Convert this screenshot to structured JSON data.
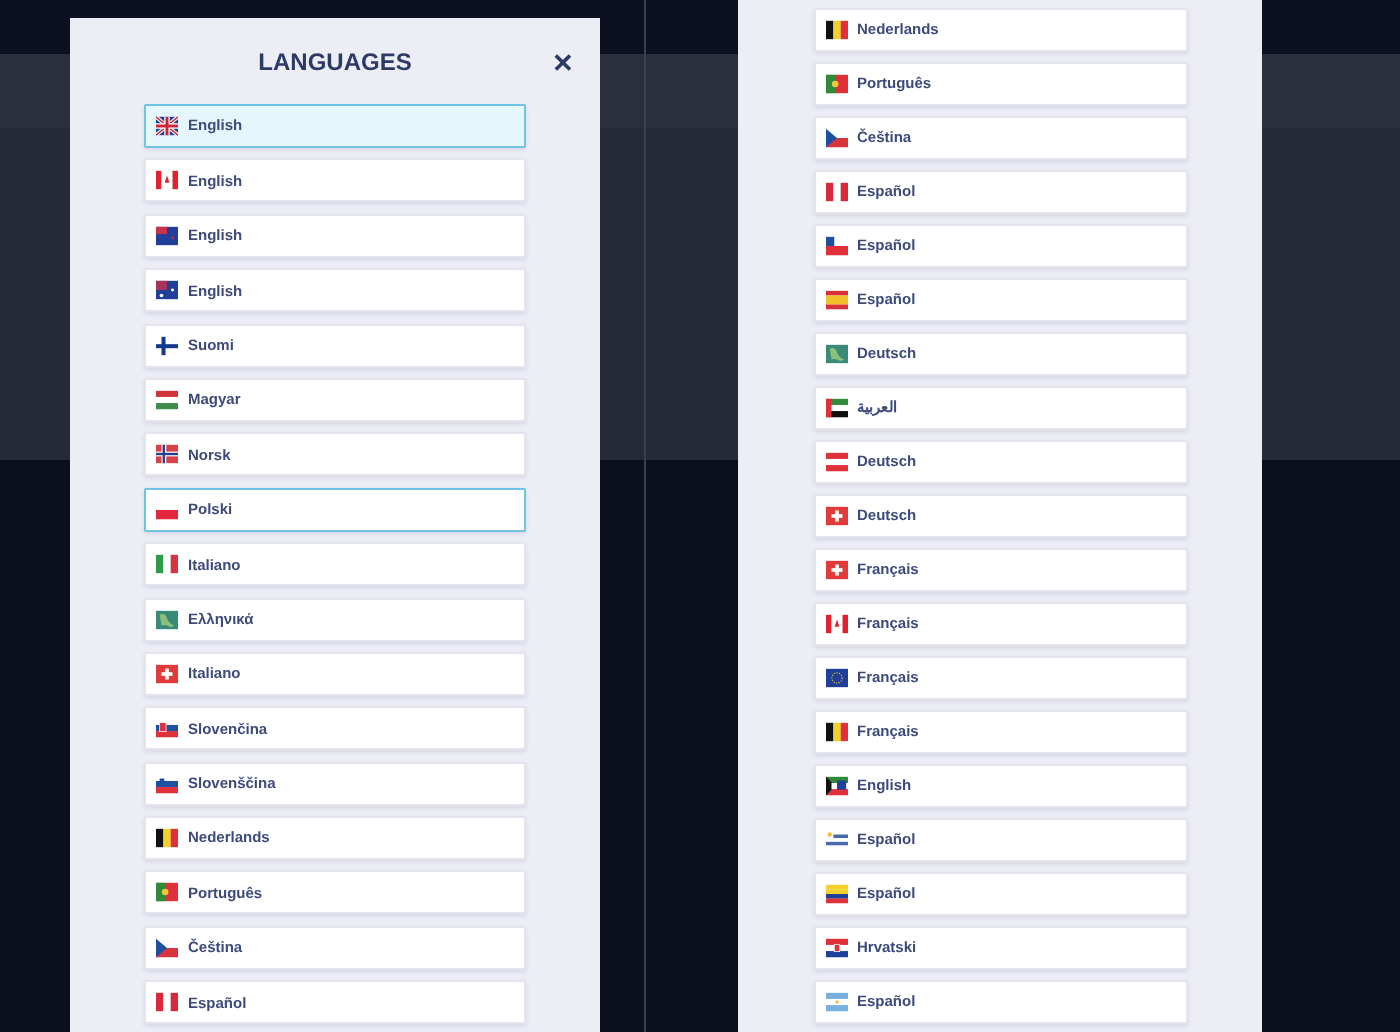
{
  "left_panel": {
    "dialog": {
      "title": "LANGUAGES",
      "close": "✕",
      "languages": [
        {
          "label": "English",
          "kind": "gb",
          "selected": true,
          "focused": false
        },
        {
          "label": "English",
          "kind": "ca",
          "selected": false,
          "focused": false
        },
        {
          "label": "English",
          "kind": "nz",
          "selected": false,
          "focused": false
        },
        {
          "label": "English",
          "kind": "au",
          "selected": false,
          "focused": false
        },
        {
          "label": "Suomi",
          "kind": "fi",
          "selected": false,
          "focused": false
        },
        {
          "label": "Magyar",
          "kind": "hu",
          "selected": false,
          "focused": false
        },
        {
          "label": "Norsk",
          "kind": "no",
          "selected": false,
          "focused": false
        },
        {
          "label": "Polski",
          "kind": "pl",
          "selected": false,
          "focused": true
        },
        {
          "label": "Italiano",
          "kind": "it",
          "selected": false,
          "focused": false
        },
        {
          "label": "Ελληνικά",
          "kind": "globe",
          "selected": false,
          "focused": false
        },
        {
          "label": "Italiano",
          "kind": "ch",
          "selected": false,
          "focused": false
        },
        {
          "label": "Slovenčina",
          "kind": "sk",
          "selected": false,
          "focused": false
        },
        {
          "label": "Slovenščina",
          "kind": "si",
          "selected": false,
          "focused": false
        },
        {
          "label": "Nederlands",
          "kind": "be",
          "selected": false,
          "focused": false
        },
        {
          "label": "Português",
          "kind": "pt",
          "selected": false,
          "focused": false
        },
        {
          "label": "Čeština",
          "kind": "cz",
          "selected": false,
          "focused": false
        },
        {
          "label": "Español",
          "kind": "pe",
          "selected": false,
          "focused": false
        }
      ]
    }
  },
  "right_panel": {
    "dialog": {
      "languages": [
        {
          "label": "Nederlands",
          "kind": "be",
          "selected": false,
          "focused": false
        },
        {
          "label": "Português",
          "kind": "pt",
          "selected": false,
          "focused": false
        },
        {
          "label": "Čeština",
          "kind": "cz",
          "selected": false,
          "focused": false
        },
        {
          "label": "Español",
          "kind": "pe",
          "selected": false,
          "focused": false
        },
        {
          "label": "Español",
          "kind": "cl",
          "selected": false,
          "focused": false
        },
        {
          "label": "Español",
          "kind": "es",
          "selected": false,
          "focused": false
        },
        {
          "label": "Deutsch",
          "kind": "globe",
          "selected": false,
          "focused": false
        },
        {
          "label": "العربية",
          "kind": "ae",
          "selected": false,
          "focused": false
        },
        {
          "label": "Deutsch",
          "kind": "at",
          "selected": false,
          "focused": false
        },
        {
          "label": "Deutsch",
          "kind": "ch",
          "selected": false,
          "focused": false
        },
        {
          "label": "Français",
          "kind": "ch",
          "selected": false,
          "focused": false
        },
        {
          "label": "Français",
          "kind": "ca",
          "selected": false,
          "focused": false
        },
        {
          "label": "Français",
          "kind": "eu",
          "selected": false,
          "focused": false
        },
        {
          "label": "Français",
          "kind": "be",
          "selected": false,
          "focused": false
        },
        {
          "label": "English",
          "kind": "kw",
          "selected": false,
          "focused": false
        },
        {
          "label": "Español",
          "kind": "uy",
          "selected": false,
          "focused": false
        },
        {
          "label": "Español",
          "kind": "co",
          "selected": false,
          "focused": false
        },
        {
          "label": "Hrvatski",
          "kind": "hr",
          "selected": false,
          "focused": false
        },
        {
          "label": "Español",
          "kind": "ar",
          "selected": false,
          "focused": false
        }
      ]
    }
  }
}
